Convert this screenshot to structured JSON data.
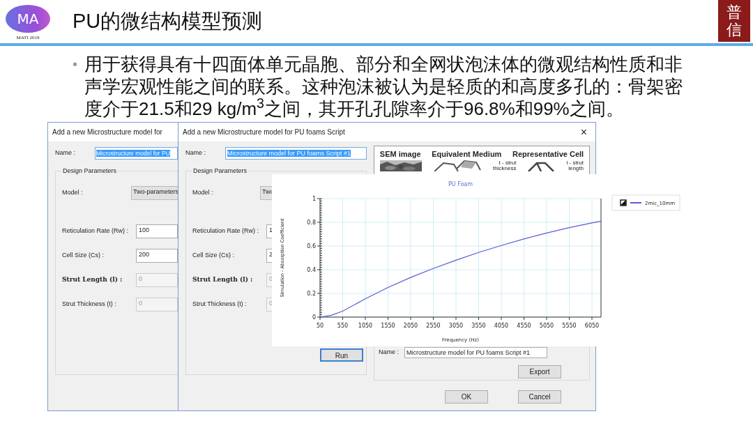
{
  "header": {
    "logo_text": "MA",
    "logo_caption": "MATI 2019",
    "title": "PU的微结构模型预测",
    "badge_text": "普信"
  },
  "bullets": [
    {
      "marker": "•",
      "text": "用于获得具有十四面体单元晶胞、部分和全网状泡沫体的微观结构性质和非声学宏观性能之间的联系。这种泡沫被认为是轻质的和高度多孔的：骨架密度介于21.5和29 kg/m$^{3}$之间，其开孔孔隙率介于96.8%和99%之间。"
    }
  ],
  "windows": [
    {
      "title": "Add a new Microstructure model for",
      "name_label": "Name :",
      "name_value": "Microstructure model for PU",
      "name_selected": true,
      "group_title": "Design Parameters",
      "fields": [
        {
          "kind": "select",
          "label": "Model :",
          "value": "Two-parameters"
        },
        {
          "kind": "input",
          "label": "Reticulation Rate (Rw) :",
          "value": "100",
          "disabled": false
        },
        {
          "kind": "input",
          "label": "Cell Size (Cs) :",
          "value": "200",
          "disabled": false
        },
        {
          "kind": "input",
          "label": "Strut Length (l) :",
          "value": "0",
          "disabled": true
        },
        {
          "kind": "input",
          "label": "Strut Thickness (t) :",
          "value": "0",
          "disabled": true
        }
      ]
    },
    {
      "title": "Add a new Microstructure model for PU foams Script",
      "close": "×",
      "name_label": "Name :",
      "name_value": "Microstructure model for PU foams Script #1",
      "name_selected": true,
      "group_title": "Design Parameters",
      "fields": [
        {
          "kind": "select",
          "label": "Model :",
          "value": "Two"
        },
        {
          "kind": "input",
          "label": "Reticulation Rate (Rw) :",
          "value": "1",
          "disabled": false
        },
        {
          "kind": "input",
          "label": "Cell Size (Cs) :",
          "value": "2",
          "disabled": false
        },
        {
          "kind": "input",
          "label": "Strut Length (l) :",
          "value": "0",
          "disabled": true
        },
        {
          "kind": "input",
          "label": "Strut Thickness (t) :",
          "value": "0",
          "disabled": true
        }
      ],
      "figure": {
        "headings": [
          "SEM image",
          "Equivalent Medium",
          "Representative Cell"
        ],
        "left_labels": [
          "t - strut",
          "thickness"
        ],
        "right_labels": [
          "l - strut",
          "length"
        ]
      },
      "run": {
        "label": "Run",
        "default": true
      },
      "material_label": "Name :",
      "material_value": "Microstructure model for PU foams Script #1",
      "export": "Export",
      "footer_buttons": [
        "OK",
        "Cancel"
      ]
    }
  ],
  "chart_panel": {
    "legend_checked": true,
    "chart_data": {
      "type": "line",
      "grid": true,
      "title": "PU Foam",
      "xlabel": "Frequency (Hz)",
      "ylabel": "Simulation - Absorption Coefficient",
      "xlim": [
        50,
        6250
      ],
      "ylim": [
        0,
        1
      ],
      "xticks": [
        50,
        550,
        1050,
        1550,
        2050,
        2550,
        3050,
        3550,
        4050,
        4550,
        5050,
        5550,
        6050
      ],
      "yticks": [
        0,
        0.2,
        0.4,
        0.6,
        0.8,
        1
      ],
      "x": [
        50,
        300,
        550,
        1050,
        1550,
        2050,
        2550,
        3050,
        3550,
        4050,
        4550,
        5050,
        5550,
        6050,
        6250
      ],
      "series": [
        {
          "name": "2mic_10mm",
          "color": "#5a5ad2",
          "values": [
            0,
            0.015,
            0.05,
            0.155,
            0.25,
            0.335,
            0.41,
            0.48,
            0.545,
            0.605,
            0.66,
            0.71,
            0.755,
            0.795,
            0.81
          ]
        }
      ]
    }
  }
}
